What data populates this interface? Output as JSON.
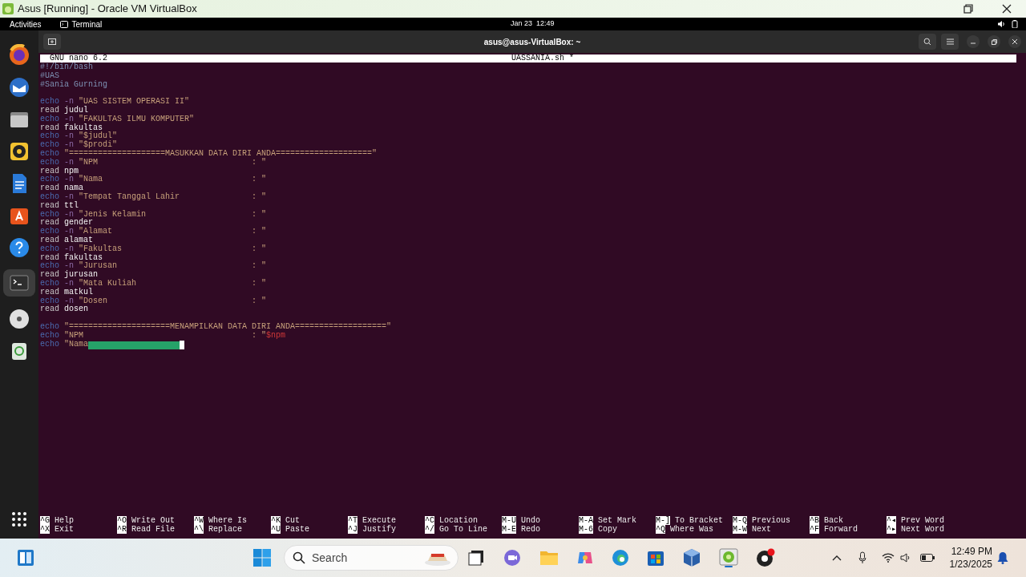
{
  "window": {
    "title": "Asus [Running] - Oracle VM VirtualBox"
  },
  "top_bar": {
    "activities": "Activities",
    "app": "Terminal",
    "clock": "Jan 23  12:49"
  },
  "dock": {
    "apps": [
      {
        "kind": "browser",
        "selected": false
      },
      {
        "kind": "mail",
        "selected": false
      },
      {
        "kind": "files",
        "selected": false
      },
      {
        "kind": "music",
        "selected": false
      },
      {
        "kind": "writer",
        "selected": false
      },
      {
        "kind": "store",
        "selected": false
      },
      {
        "kind": "help",
        "selected": false
      },
      {
        "kind": "terminal",
        "selected": true
      },
      {
        "kind": "disc",
        "selected": false
      },
      {
        "kind": "trash",
        "selected": false
      }
    ]
  },
  "terminal": {
    "title": "asus@asus-VirtualBox: ~"
  },
  "nano": {
    "version": "GNU nano 6.2",
    "filename": "UASSANIA.sh *",
    "lines": [
      {
        "kind": "code",
        "cursor": false,
        "segments": [
          {
            "kind": "comment",
            "text": "#!/bin/bash"
          }
        ]
      },
      {
        "kind": "code",
        "cursor": false,
        "segments": [
          {
            "kind": "comment",
            "text": "#UAS"
          }
        ]
      },
      {
        "kind": "code",
        "cursor": false,
        "segments": [
          {
            "kind": "comment",
            "text": "#Sania Gurning"
          }
        ]
      },
      {
        "kind": "blank"
      },
      {
        "kind": "code",
        "cursor": false,
        "segments": [
          {
            "kind": "keyword",
            "text": "echo"
          },
          {
            "kind": "flag",
            "text": "-n"
          },
          {
            "kind": "string",
            "text": "\"UAS SISTEM OPERASI II\""
          }
        ]
      },
      {
        "kind": "code",
        "cursor": false,
        "segments": [
          {
            "kind": "command",
            "text": "read"
          },
          {
            "kind": "arg",
            "text": "judul"
          }
        ]
      },
      {
        "kind": "code",
        "cursor": false,
        "segments": [
          {
            "kind": "keyword",
            "text": "echo"
          },
          {
            "kind": "flag",
            "text": "-n"
          },
          {
            "kind": "string",
            "text": "\"FAKULTAS ILMU KOMPUTER\""
          }
        ]
      },
      {
        "kind": "code",
        "cursor": false,
        "segments": [
          {
            "kind": "command",
            "text": "read"
          },
          {
            "kind": "arg",
            "text": "fakultas"
          }
        ]
      },
      {
        "kind": "code",
        "cursor": false,
        "segments": [
          {
            "kind": "keyword",
            "text": "echo"
          },
          {
            "kind": "flag",
            "text": "-n"
          },
          {
            "kind": "string",
            "text": "\"$judul\""
          }
        ]
      },
      {
        "kind": "code",
        "cursor": false,
        "segments": [
          {
            "kind": "keyword",
            "text": "echo"
          },
          {
            "kind": "flag",
            "text": "-n"
          },
          {
            "kind": "string",
            "text": "\"$prodi\""
          }
        ]
      },
      {
        "kind": "code",
        "cursor": false,
        "segments": [
          {
            "kind": "keyword",
            "text": "echo"
          },
          {
            "kind": "string",
            "text": "\"====================MASUKKAN DATA DIRI ANDA====================\""
          }
        ]
      },
      {
        "kind": "code",
        "cursor": false,
        "segments": [
          {
            "kind": "keyword",
            "text": "echo"
          },
          {
            "kind": "flag",
            "text": "-n"
          },
          {
            "kind": "label",
            "text": "\"NPM"
          },
          {
            "kind": "string",
            "text": ": \""
          }
        ]
      },
      {
        "kind": "code",
        "cursor": false,
        "segments": [
          {
            "kind": "command",
            "text": "read"
          },
          {
            "kind": "arg",
            "text": "npm"
          }
        ]
      },
      {
        "kind": "code",
        "cursor": false,
        "segments": [
          {
            "kind": "keyword",
            "text": "echo"
          },
          {
            "kind": "flag",
            "text": "-n"
          },
          {
            "kind": "label",
            "text": "\"Nama"
          },
          {
            "kind": "string",
            "text": ": \""
          }
        ]
      },
      {
        "kind": "code",
        "cursor": false,
        "segments": [
          {
            "kind": "command",
            "text": "read"
          },
          {
            "kind": "arg",
            "text": "nama"
          }
        ]
      },
      {
        "kind": "code",
        "cursor": false,
        "segments": [
          {
            "kind": "keyword",
            "text": "echo"
          },
          {
            "kind": "flag",
            "text": "-n"
          },
          {
            "kind": "label",
            "text": "\"Tempat Tanggal Lahir"
          },
          {
            "kind": "string",
            "text": ": \""
          }
        ]
      },
      {
        "kind": "code",
        "cursor": false,
        "segments": [
          {
            "kind": "command",
            "text": "read"
          },
          {
            "kind": "arg",
            "text": "ttl"
          }
        ]
      },
      {
        "kind": "code",
        "cursor": false,
        "segments": [
          {
            "kind": "keyword",
            "text": "echo"
          },
          {
            "kind": "flag",
            "text": "-n"
          },
          {
            "kind": "label",
            "text": "\"Jenis Kelamin"
          },
          {
            "kind": "string",
            "text": ": \""
          }
        ]
      },
      {
        "kind": "code",
        "cursor": false,
        "segments": [
          {
            "kind": "command",
            "text": "read"
          },
          {
            "kind": "arg",
            "text": "gender"
          }
        ]
      },
      {
        "kind": "code",
        "cursor": false,
        "segments": [
          {
            "kind": "keyword",
            "text": "echo"
          },
          {
            "kind": "flag",
            "text": "-n"
          },
          {
            "kind": "label",
            "text": "\"Alamat"
          },
          {
            "kind": "string",
            "text": ": \""
          }
        ]
      },
      {
        "kind": "code",
        "cursor": false,
        "segments": [
          {
            "kind": "command",
            "text": "read"
          },
          {
            "kind": "arg",
            "text": "alamat"
          }
        ]
      },
      {
        "kind": "code",
        "cursor": false,
        "segments": [
          {
            "kind": "keyword",
            "text": "echo"
          },
          {
            "kind": "flag",
            "text": "-n"
          },
          {
            "kind": "label",
            "text": "\"Fakultas"
          },
          {
            "kind": "string",
            "text": ": \""
          }
        ]
      },
      {
        "kind": "code",
        "cursor": false,
        "segments": [
          {
            "kind": "command",
            "text": "read"
          },
          {
            "kind": "arg",
            "text": "fakultas"
          }
        ]
      },
      {
        "kind": "code",
        "cursor": false,
        "segments": [
          {
            "kind": "keyword",
            "text": "echo"
          },
          {
            "kind": "flag",
            "text": "-n"
          },
          {
            "kind": "label",
            "text": "\"Jurusan"
          },
          {
            "kind": "string",
            "text": ": \""
          }
        ]
      },
      {
        "kind": "code",
        "cursor": false,
        "segments": [
          {
            "kind": "command",
            "text": "read"
          },
          {
            "kind": "arg",
            "text": "jurusan"
          }
        ]
      },
      {
        "kind": "code",
        "cursor": false,
        "segments": [
          {
            "kind": "keyword",
            "text": "echo"
          },
          {
            "kind": "flag",
            "text": "-n"
          },
          {
            "kind": "label",
            "text": "\"Mata Kuliah"
          },
          {
            "kind": "string",
            "text": ": \""
          }
        ]
      },
      {
        "kind": "code",
        "cursor": false,
        "segments": [
          {
            "kind": "command",
            "text": "read"
          },
          {
            "kind": "arg",
            "text": "matkul"
          }
        ]
      },
      {
        "kind": "code",
        "cursor": false,
        "segments": [
          {
            "kind": "keyword",
            "text": "echo"
          },
          {
            "kind": "flag",
            "text": "-n"
          },
          {
            "kind": "label",
            "text": "\"Dosen"
          },
          {
            "kind": "string",
            "text": ": \""
          }
        ]
      },
      {
        "kind": "code",
        "cursor": false,
        "segments": [
          {
            "kind": "command",
            "text": "read"
          },
          {
            "kind": "arg",
            "text": "dosen"
          }
        ]
      },
      {
        "kind": "blank"
      },
      {
        "kind": "code",
        "cursor": false,
        "segments": [
          {
            "kind": "keyword",
            "text": "echo"
          },
          {
            "kind": "string",
            "text": "\"=====================MENAMPILKAN DATA DIRI ANDA===================\""
          }
        ]
      },
      {
        "kind": "code",
        "cursor": false,
        "segments": [
          {
            "kind": "keyword",
            "text": "echo"
          },
          {
            "kind": "label",
            "text": "\"NPM"
          },
          {
            "kind": "string",
            "text": ": \""
          },
          {
            "kind": "variable",
            "text": "$npm"
          }
        ]
      },
      {
        "kind": "code",
        "cursor": true,
        "segments": [
          {
            "kind": "keyword",
            "text": "echo"
          },
          {
            "kind": "string",
            "text": "\"Nama"
          }
        ]
      }
    ],
    "shortcuts": [
      [
        {
          "key": "^G",
          "label": "Help"
        },
        {
          "key": "^X",
          "label": "Exit"
        }
      ],
      [
        {
          "key": "^O",
          "label": "Write Out"
        },
        {
          "key": "^R",
          "label": "Read File"
        }
      ],
      [
        {
          "key": "^W",
          "label": "Where Is"
        },
        {
          "key": "^\\",
          "label": "Replace"
        }
      ],
      [
        {
          "key": "^K",
          "label": "Cut"
        },
        {
          "key": "^U",
          "label": "Paste"
        }
      ],
      [
        {
          "key": "^T",
          "label": "Execute"
        },
        {
          "key": "^J",
          "label": "Justify"
        }
      ],
      [
        {
          "key": "^C",
          "label": "Location"
        },
        {
          "key": "^/",
          "label": "Go To Line"
        }
      ],
      [
        {
          "key": "M-U",
          "label": "Undo"
        },
        {
          "key": "M-E",
          "label": "Redo"
        }
      ],
      [
        {
          "key": "M-A",
          "label": "Set Mark"
        },
        {
          "key": "M-6",
          "label": "Copy"
        }
      ],
      [
        {
          "key": "M-]",
          "label": "To Bracket"
        },
        {
          "key": "^Q",
          "label": "Where Was"
        }
      ],
      [
        {
          "key": "M-Q",
          "label": "Previous"
        },
        {
          "key": "M-W",
          "label": "Next"
        }
      ],
      [
        {
          "key": "^B",
          "label": "Back"
        },
        {
          "key": "^F",
          "label": "Forward"
        }
      ],
      [
        {
          "key": "^◂",
          "label": "Prev Word"
        },
        {
          "key": "^▸",
          "label": "Next Word"
        }
      ]
    ]
  },
  "taskbar": {
    "search_placeholder": "Search",
    "time": "12:49 PM",
    "date": "1/23/2025"
  }
}
